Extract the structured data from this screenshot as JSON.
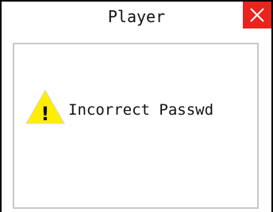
{
  "window": {
    "title": "Player",
    "close_icon": "close-icon"
  },
  "dialog": {
    "icon": "warning-icon",
    "icon_glyph": "!",
    "message": "Incorrect Passwd"
  },
  "colors": {
    "close_bg": "#e8241c",
    "warning_fill": "#ffee00",
    "content_border": "#c8c8c8",
    "frame": "#000000"
  }
}
